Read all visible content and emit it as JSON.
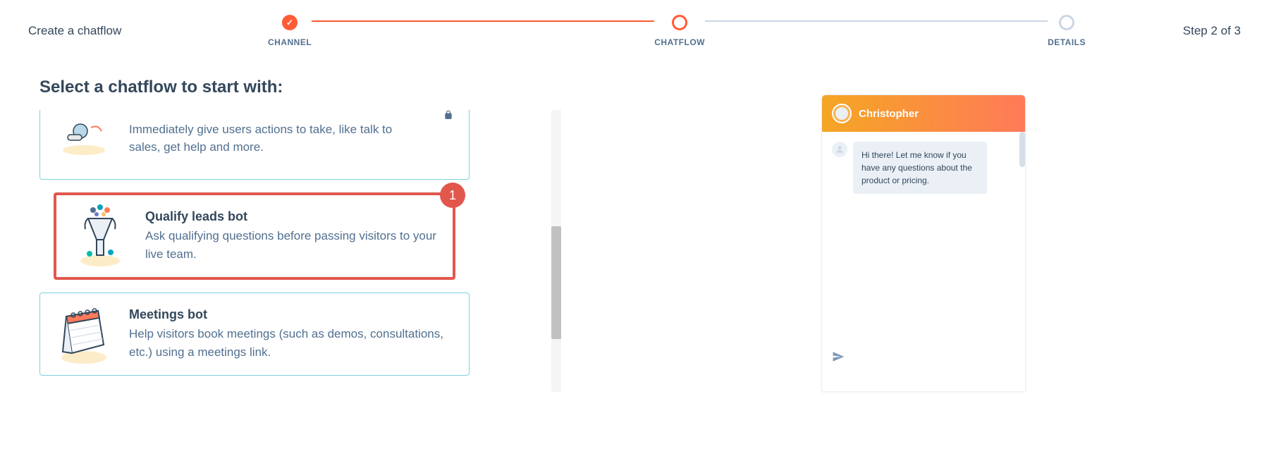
{
  "header": {
    "breadcrumb": "Create a chatflow",
    "step_indicator": "Step 2 of 3"
  },
  "stepper": {
    "steps": [
      {
        "label": "CHANNEL",
        "state": "done"
      },
      {
        "label": "CHATFLOW",
        "state": "active"
      },
      {
        "label": "DETAILS",
        "state": "pending"
      }
    ]
  },
  "page": {
    "title": "Select a chatflow to start with:"
  },
  "options": [
    {
      "id": "concierge",
      "icon": "concierge-icon",
      "title": "",
      "description": "Immediately give users actions to take, like talk to sales, get help and more.",
      "locked": true,
      "partial": true
    },
    {
      "id": "qualify-leads",
      "icon": "funnel-icon",
      "title": "Qualify leads bot",
      "description": "Ask qualifying questions before passing visitors to your live team.",
      "highlighted": true,
      "badge": "1"
    },
    {
      "id": "meetings",
      "icon": "calendar-icon",
      "title": "Meetings bot",
      "description": "Help visitors book meetings (such as demos, consultations, etc.) using a meetings link."
    }
  ],
  "preview": {
    "agent_name": "Christopher",
    "messages": [
      {
        "text": "Hi there! Let me know if you have any questions about the product or pricing."
      }
    ]
  }
}
